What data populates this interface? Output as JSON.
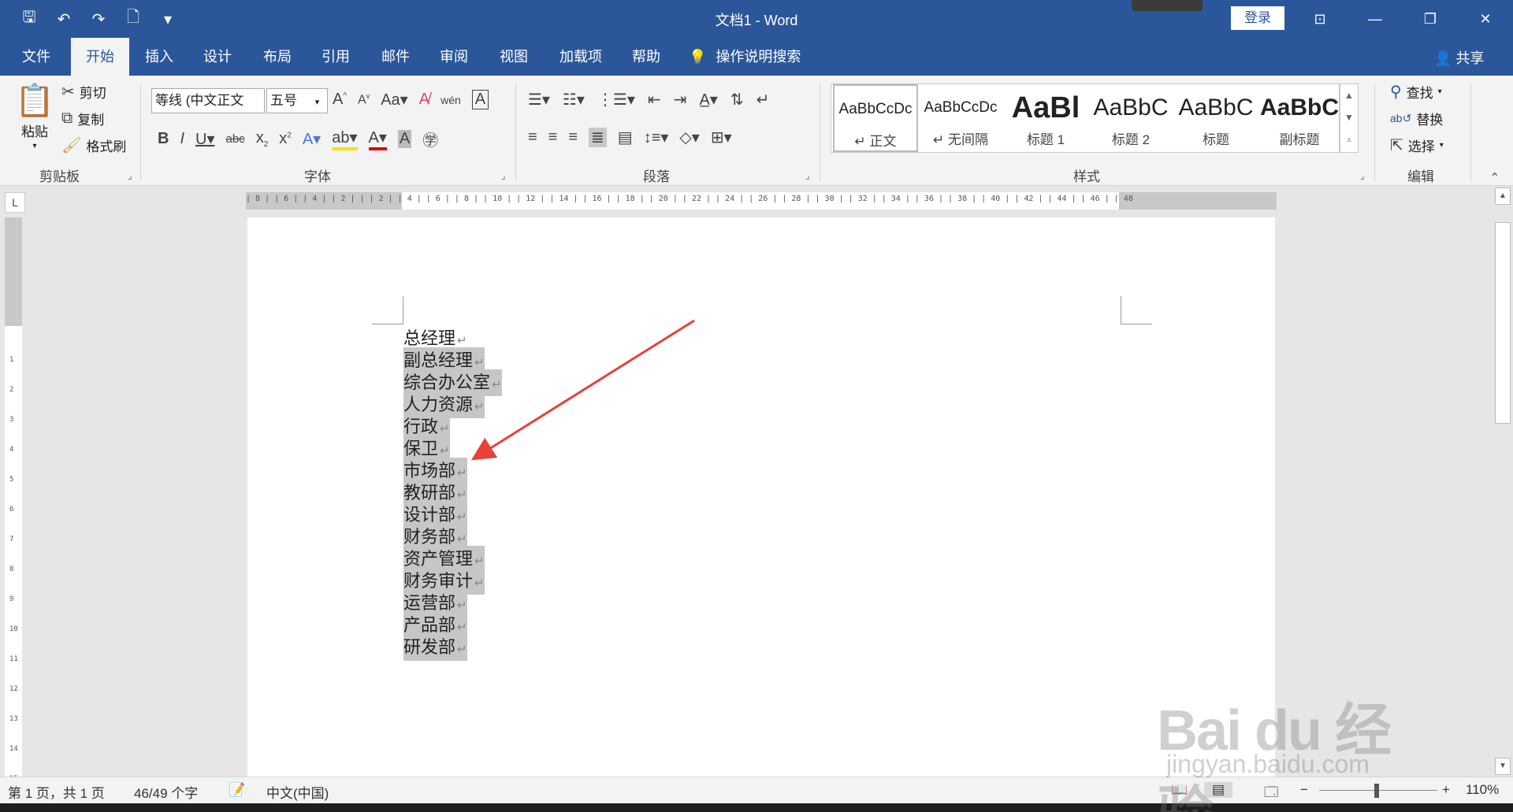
{
  "window": {
    "title": "文档1 - Word",
    "login": "登录"
  },
  "tabs": [
    "文件",
    "开始",
    "插入",
    "设计",
    "布局",
    "引用",
    "邮件",
    "审阅",
    "视图",
    "加载项",
    "帮助"
  ],
  "active_tab": "开始",
  "search_hint": "操作说明搜索",
  "share": "共享",
  "clipboard": {
    "paste": "粘贴",
    "cut": "剪切",
    "copy": "复制",
    "format_painter": "格式刷",
    "group_label": "剪贴板"
  },
  "font": {
    "font_name": "等线 (中文正文",
    "font_size": "五号",
    "group_label": "字体"
  },
  "paragraph": {
    "group_label": "段落"
  },
  "styles": {
    "group_label": "样式",
    "items": [
      {
        "preview": "AaBbCcDc",
        "name": "↵ 正文"
      },
      {
        "preview": "AaBbCcDc",
        "name": "↵ 无间隔"
      },
      {
        "preview": "AaBl",
        "name": "标题 1"
      },
      {
        "preview": "AaBbC",
        "name": "标题 2"
      },
      {
        "preview": "AaBbC",
        "name": "标题"
      },
      {
        "preview": "AaBbC",
        "name": "副标题"
      }
    ]
  },
  "editing": {
    "find": "查找",
    "replace": "替换",
    "select": "选择",
    "group_label": "编辑"
  },
  "document": {
    "paragraphs": [
      {
        "text": "总经理",
        "selected": false
      },
      {
        "text": "副总经理",
        "selected": true
      },
      {
        "text": "综合办公室",
        "selected": true
      },
      {
        "text": "人力资源",
        "selected": true
      },
      {
        "text": "行政",
        "selected": true
      },
      {
        "text": "保卫",
        "selected": true
      },
      {
        "text": "市场部",
        "selected": true
      },
      {
        "text": "教研部",
        "selected": true
      },
      {
        "text": "设计部",
        "selected": true
      },
      {
        "text": "财务部",
        "selected": true
      },
      {
        "text": "资产管理",
        "selected": true
      },
      {
        "text": "财务审计",
        "selected": true
      },
      {
        "text": "运营部",
        "selected": true
      },
      {
        "text": "产品部",
        "selected": true
      },
      {
        "text": "研发部",
        "selected": true
      }
    ],
    "paragraph_mark": "↵"
  },
  "status": {
    "page": "第 1 页，共 1 页",
    "words": "46/49 个字",
    "language": "中文(中国)",
    "zoom": "110%"
  },
  "ruler_ticks": "| 8 |  | 6 |  | 4 |  | 2 |  |  | 2 |  | 4 |  | 6 |  | 8 |  | 10 |  | 12 |  | 14 |  | 16 |  | 18 |  | 20 |  | 22 |  | 24 |  | 26 |  | 28 |  | 30 |  | 32 |  | 34 |  | 36 |  | 38 |  | 40 |  | 42 |  | 44 |  | 46 |  | 48",
  "watermark": {
    "brand": "Bai du 经验",
    "url": "jingyan.baidu.com"
  },
  "colors": {
    "accent": "#2b579a",
    "selection": "#c6c6c6",
    "arrow": "#e8403a"
  }
}
